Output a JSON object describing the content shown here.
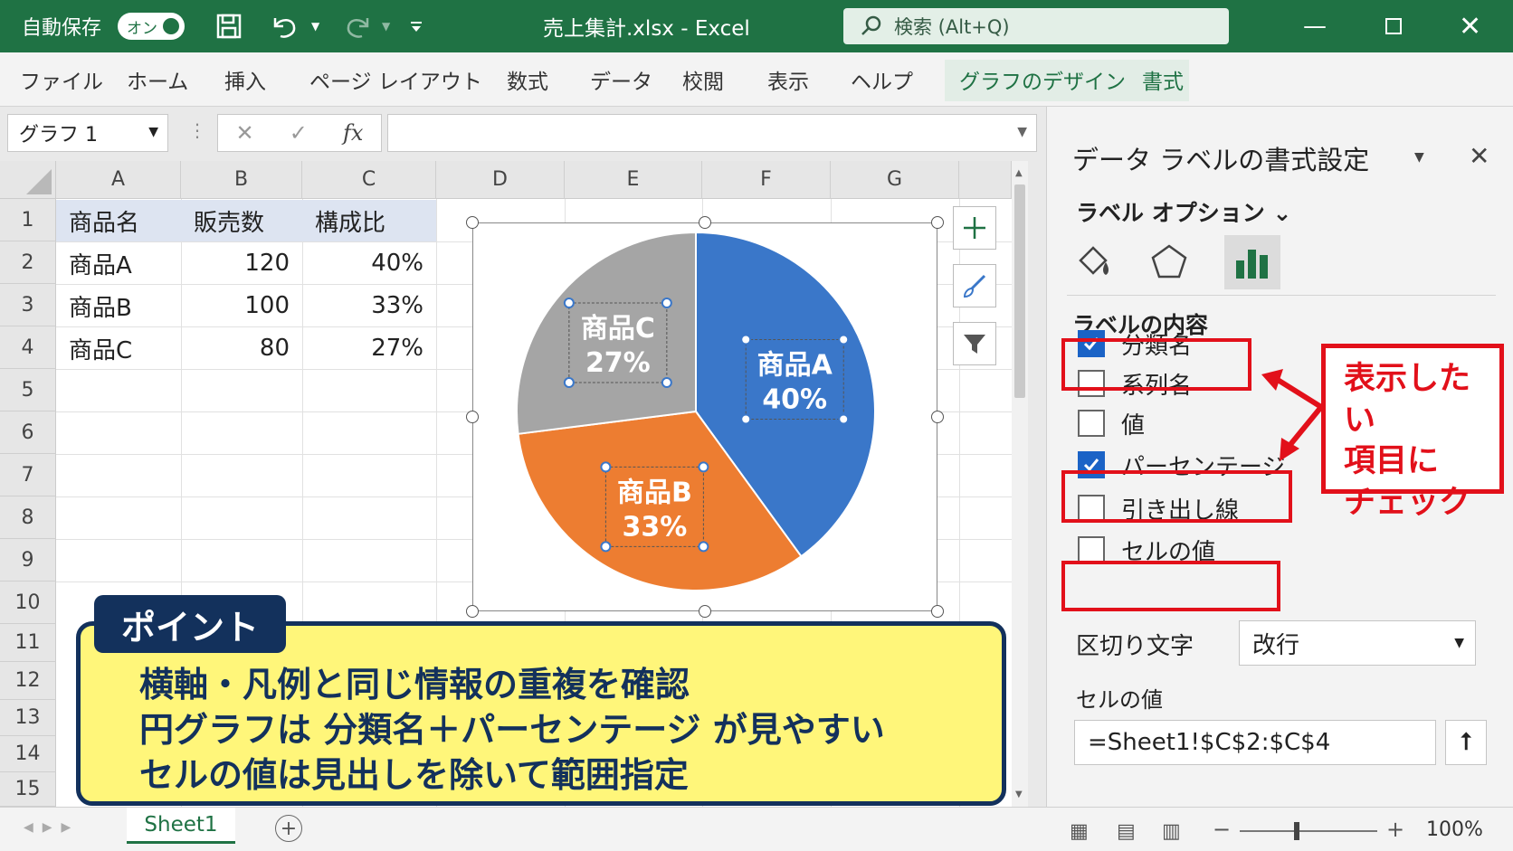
{
  "titlebar": {
    "autosave_label": "自動保存",
    "autosave_state": "オン",
    "doc_title": "売上集計.xlsx  -  Excel",
    "search_placeholder": "検索 (Alt+Q)",
    "bg_color": "#1f7244"
  },
  "ribbon": {
    "tabs": [
      "ファイル",
      "ホーム",
      "挿入",
      "ページ レイアウト",
      "数式",
      "データ",
      "校閲",
      "表示",
      "ヘルプ"
    ],
    "context_tabs": [
      "グラフのデザイン",
      "書式"
    ]
  },
  "formula_bar": {
    "name_box": "グラフ 1",
    "cancel": "✕",
    "enter": "✓",
    "fx": "fx",
    "formula": ""
  },
  "sheet": {
    "columns": [
      "A",
      "B",
      "C",
      "D",
      "E",
      "F",
      "G"
    ],
    "rows": [
      "1",
      "2",
      "3",
      "4",
      "5",
      "6",
      "7",
      "8",
      "9",
      "10",
      "11",
      "12",
      "13",
      "14",
      "15"
    ],
    "table": {
      "headers": [
        "商品名",
        "販売数",
        "構成比"
      ],
      "data": [
        [
          "商品A",
          "120",
          "40%"
        ],
        [
          "商品B",
          "100",
          "33%"
        ],
        [
          "商品C",
          "80",
          "27%"
        ]
      ]
    },
    "tab_name": "Sheet1"
  },
  "chart_data": {
    "type": "pie",
    "categories": [
      "商品A",
      "商品B",
      "商品C"
    ],
    "values": [
      40,
      33,
      27
    ],
    "labels": [
      {
        "name": "商品A",
        "pct": "40%"
      },
      {
        "name": "商品B",
        "pct": "33%"
      },
      {
        "name": "商品C",
        "pct": "27%"
      }
    ],
    "colors": [
      "#3a77c9",
      "#ed7d31",
      "#a5a5a5"
    ],
    "title": ""
  },
  "callout": {
    "tag": "ポイント",
    "lines": [
      "横軸・凡例と同じ情報の重複を確認",
      "円グラフは 分類名＋パーセンテージ が見やすい",
      "セルの値は見出しを除いて範囲指定"
    ],
    "bg_color": "#fff67a",
    "border_color": "#13315c"
  },
  "pane": {
    "title": "データ ラベルの書式設定",
    "label_options": "ラベル オプション",
    "section": "ラベルの内容",
    "checkboxes": [
      {
        "label": "分類名",
        "checked": true
      },
      {
        "label": "系列名",
        "checked": false
      },
      {
        "label": "値",
        "checked": false
      },
      {
        "label": "パーセンテージ",
        "checked": true
      },
      {
        "label": "引き出し線",
        "checked": false
      },
      {
        "label": "セルの値",
        "checked": false
      }
    ],
    "separator_label": "区切り文字",
    "separator_value": "改行",
    "cell_value_label": "セルの値",
    "cell_value_range": "=Sheet1!$C$2:$C$4",
    "annotation": "表示したい 項目に チェック",
    "annotation_lines": [
      "表示したい",
      "項目に",
      "チェック"
    ],
    "highlight_color": "#e2101a"
  },
  "status": {
    "zoom": "100%"
  }
}
